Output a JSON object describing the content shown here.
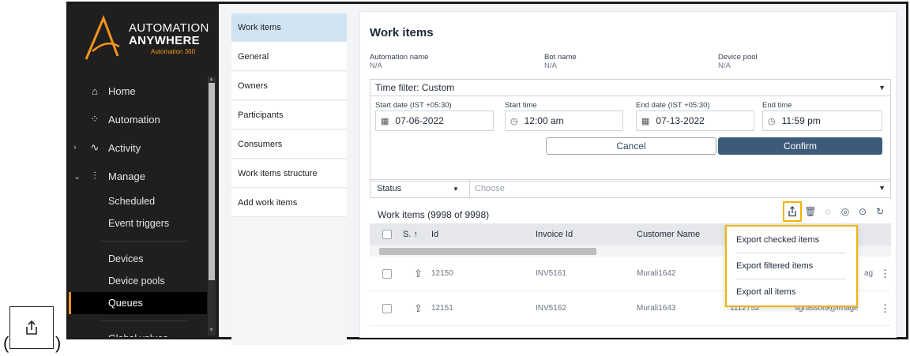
{
  "brand": {
    "line1": "AUTOMATION",
    "line2": "ANYWHERE",
    "line3": "Automation 360",
    "accent": "#f7931e"
  },
  "sidebar": {
    "items": [
      {
        "label": "Home",
        "icon": "home-icon"
      },
      {
        "label": "Automation",
        "icon": "automation-icon"
      },
      {
        "label": "Activity",
        "icon": "activity-icon"
      },
      {
        "label": "Manage",
        "icon": "manage-icon"
      }
    ],
    "subitems": [
      "Scheduled",
      "Event triggers",
      "Devices",
      "Device pools",
      "Queues",
      "Global values"
    ],
    "active": "Queues"
  },
  "submenu": {
    "items": [
      "Work items",
      "General",
      "Owners",
      "Participants",
      "Consumers",
      "Work items structure",
      "Add work items"
    ],
    "active": "Work items"
  },
  "main": {
    "title": "Work items",
    "meta": [
      {
        "label": "Automation name",
        "value": "N/A"
      },
      {
        "label": "Bot name",
        "value": "N/A"
      },
      {
        "label": "Device pool",
        "value": "N/A"
      }
    ],
    "time_filter": "Time filter: Custom",
    "start_date_label": "Start date (IST +05:30)",
    "start_date": "07-06-2022",
    "start_time_label": "Start time",
    "start_time": "12:00 am",
    "end_date_label": "End date (IST +05:30)",
    "end_date": "07-13-2022",
    "end_time_label": "End time",
    "end_time": "11:59 pm",
    "cancel": "Cancel",
    "confirm": "Confirm",
    "status_label": "Status",
    "choose_placeholder": "Choose",
    "count": "Work items (9998 of 9998)"
  },
  "table": {
    "headers": [
      "S.",
      "Id",
      "Invoice Id",
      "Customer Name"
    ],
    "rows": [
      {
        "id": "12150",
        "invoice": "INV5161",
        "customer": "Murali1642",
        "email_fragment": "ag"
      },
      {
        "id": "12151",
        "invoice": "INV5162",
        "customer": "Murali1643",
        "extra": "1112752",
        "email_fragment": "sgrassot9@image"
      }
    ]
  },
  "export_menu": {
    "items": [
      "Export checked items",
      "Export filtered items",
      "Export all items"
    ],
    "highlight": "#f0b400"
  },
  "colors": {
    "primary_button": "#3d5a7a",
    "active_submenu": "#cfe3f3",
    "sidebar_bg": "#1f1f1f"
  }
}
